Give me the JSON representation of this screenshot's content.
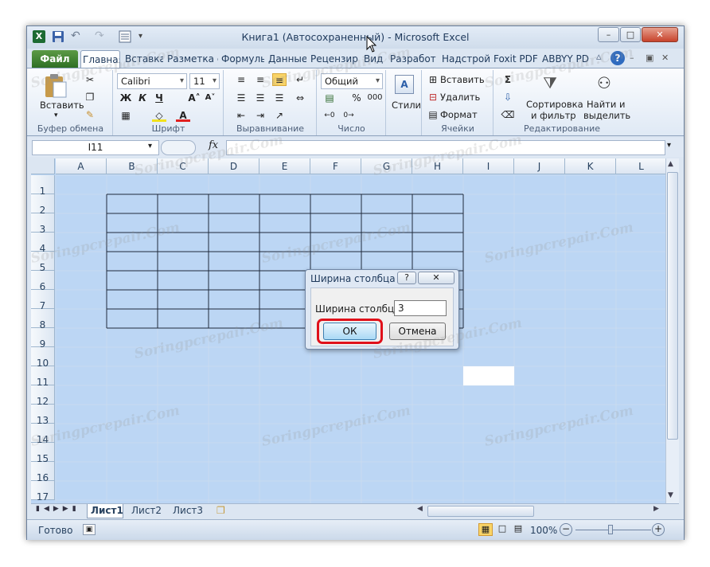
{
  "window": {
    "title": "Книга1 (Автосохраненный)  -  Microsoft Excel",
    "minimize": "–",
    "maximize": "□",
    "close": "✕"
  },
  "tabs": [
    "Файл",
    "Главная",
    "Вставка",
    "Разметка с",
    "Формулы",
    "Данные",
    "Рецензир",
    "Вид",
    "Разработ",
    "Надстрой",
    "Foxit PDF",
    "ABBYY PDF"
  ],
  "ribbon": {
    "clipboard": {
      "paste": "Вставить",
      "label": "Буфер обмена"
    },
    "font": {
      "name": "Calibri",
      "size": "11",
      "bold": "Ж",
      "italic": "К",
      "underline": "Ч",
      "label": "Шрифт"
    },
    "alignment": {
      "label": "Выравнивание"
    },
    "number": {
      "format": "Общий",
      "percent": "%",
      "thousands": "000",
      "label": "Число"
    },
    "styles": {
      "label": "Стили"
    },
    "cells": {
      "insert": "Вставить",
      "delete": "Удалить",
      "format": "Формат",
      "label": "Ячейки"
    },
    "editing": {
      "sum": "Σ",
      "sort": "Сортировка",
      "sort2": "и фильтр",
      "find": "Найти и",
      "find2": "выделить",
      "label": "Редактирование"
    }
  },
  "formula_bar": {
    "name_box": "I11",
    "fx": "fx",
    "value": ""
  },
  "sheet": {
    "columns": [
      "A",
      "B",
      "C",
      "D",
      "E",
      "F",
      "G",
      "H",
      "I",
      "J",
      "K",
      "L"
    ],
    "rows": [
      "1",
      "2",
      "3",
      "4",
      "5",
      "6",
      "7",
      "8",
      "9",
      "10",
      "11",
      "12",
      "13",
      "14",
      "15",
      "16",
      "17"
    ]
  },
  "sheet_tabs": [
    "Лист1",
    "Лист2",
    "Лист3"
  ],
  "status": {
    "ready": "Готово",
    "zoom": "100%"
  },
  "dialog": {
    "title": "Ширина столбца",
    "help": "?",
    "close": "✕",
    "field_label": "Ширина столбца:",
    "field_value": "3",
    "ok": "ОК",
    "cancel": "Отмена"
  },
  "watermark": "Soringpcrepair.Com"
}
